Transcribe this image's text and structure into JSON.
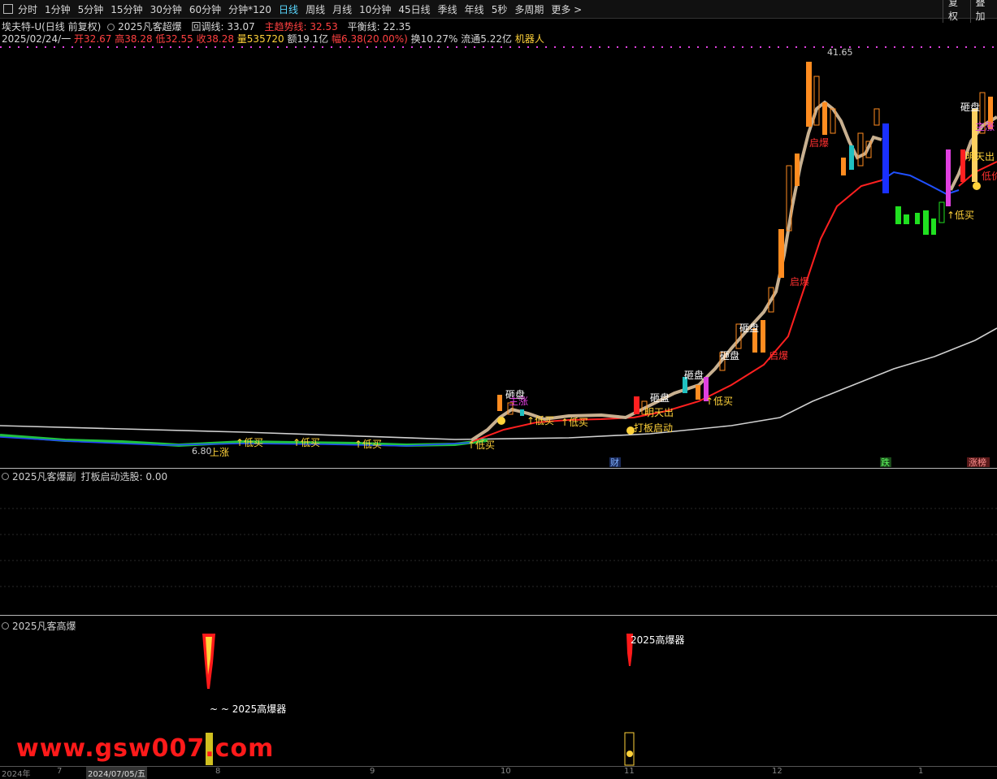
{
  "toolbar": {
    "tabs": [
      "分时",
      "1分钟",
      "5分钟",
      "15分钟",
      "30分钟",
      "60分钟",
      "分钟*120",
      "日线",
      "周线",
      "月线",
      "10分钟",
      "45日线",
      "季线",
      "年线",
      "5秒",
      "多周期",
      "更多 >"
    ],
    "active": "日线",
    "right": [
      "复权",
      "叠加"
    ]
  },
  "header": {
    "stock": "埃夫特-U(日线 前复权)",
    "indicator": "2025凡客超爆",
    "huitiao_label": "回调线: 33.07",
    "zhuqu_label": "主趋势线: 32.53",
    "pingheng_label": "平衡线: 22.35"
  },
  "quote": {
    "date": "2025/02/24/一",
    "open": "开32.67",
    "high": "高38.28",
    "low": "低32.55",
    "close": "收38.28",
    "vol": "量535720",
    "amount": "额19.1亿",
    "change": "幅6.38(20.00%)",
    "turnover": "换10.27%",
    "float": "流通5.22亿",
    "robot": "机器人"
  },
  "main_chart": {
    "price_high": "41.65",
    "price_low": "6.80",
    "labels": {
      "zaguan": "砸盘",
      "dimai": "↑低买",
      "qibao": "启爆",
      "mingtianchu": "明天出",
      "dabanqidong": "打板启动",
      "zhuzhang": "主涨",
      "shangzhang": "上涨",
      "xianjia": "低价"
    },
    "markers": {
      "cai": "财",
      "die": "跌",
      "zhangting": "涨榜"
    }
  },
  "sub1": {
    "title": "2025凡客爆副",
    "value": "打板启动选股: 0.00"
  },
  "sub2": {
    "title": "2025凡客高爆",
    "label1": "~ ~ 2025高爆器",
    "label2": "2025高爆器"
  },
  "axis": {
    "labels": [
      "2024年",
      "7",
      "2024/07/05/五",
      "8",
      "9",
      "10",
      "11",
      "12",
      "1"
    ]
  },
  "watermark": "www.gsw007.com",
  "colors": {
    "bg": "#000000",
    "up": "#ff3030",
    "down": "#00c0c0",
    "ma_red": "#ff2020",
    "ma_tan": "#c8b090",
    "ma_white": "#d0d0d0",
    "ma_blue": "#2040ff"
  }
}
